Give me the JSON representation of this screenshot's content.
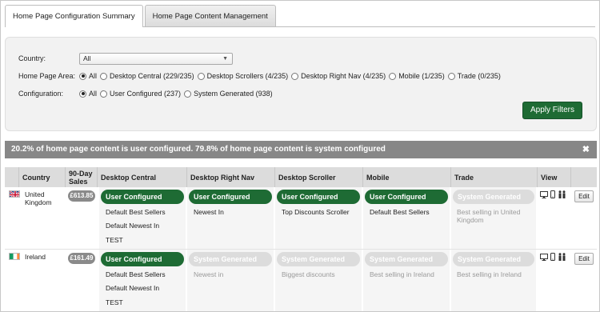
{
  "tabs": [
    {
      "label": "Home Page Configuration Summary",
      "active": true
    },
    {
      "label": "Home Page Content Management",
      "active": false
    }
  ],
  "filters": {
    "country_label": "Country:",
    "country_value": "All",
    "area_label": "Home Page Area:",
    "area_options": [
      "All",
      "Desktop Central (229/235)",
      "Desktop Scrollers (4/235)",
      "Desktop Right Nav (4/235)",
      "Mobile (1/235)",
      "Trade (0/235)"
    ],
    "area_selected": "All",
    "config_label": "Configuration:",
    "config_options": [
      "All",
      "User Configured (237)",
      "System Generated (938)"
    ],
    "config_selected": "All",
    "apply_label": "Apply Filters"
  },
  "summary": {
    "text": "20.2% of home page content is user configured. 79.8% of home page content is system configured",
    "close": "✖"
  },
  "table": {
    "headers": {
      "country": "Country",
      "sales": "90-Day Sales",
      "desktop_central": "Desktop Central",
      "desktop_right_nav": "Desktop Right Nav",
      "desktop_scroller": "Desktop Scroller",
      "mobile": "Mobile",
      "trade": "Trade",
      "view": "View"
    },
    "edit_label": "Edit",
    "rows": [
      {
        "country": "United Kingdom",
        "sales": "£613.85",
        "desktop_central": {
          "status": "User Configured",
          "items": [
            "Default Best Sellers",
            "Default Newest In",
            "TEST"
          ]
        },
        "desktop_right_nav": {
          "status": "User Configured",
          "items": [
            "Newest In"
          ]
        },
        "desktop_scroller": {
          "status": "User Configured",
          "items": [
            "Top Discounts Scroller"
          ]
        },
        "mobile": {
          "status": "User Configured",
          "items": [
            "Default Best Sellers"
          ]
        },
        "trade": {
          "status": "System Generated",
          "items": [
            "Best selling in United Kingdom"
          ]
        }
      },
      {
        "country": "Ireland",
        "sales": "£161.49",
        "desktop_central": {
          "status": "User Configured",
          "items": [
            "Default Best Sellers",
            "Default Newest In",
            "TEST"
          ]
        },
        "desktop_right_nav": {
          "status": "System Generated",
          "items": [
            "Newest in"
          ]
        },
        "desktop_scroller": {
          "status": "System Generated",
          "items": [
            "Biggest discounts"
          ]
        },
        "mobile": {
          "status": "System Generated",
          "items": [
            "Best selling in Ireland"
          ]
        },
        "trade": {
          "status": "System Generated",
          "items": [
            "Best selling in Ireland"
          ]
        }
      }
    ]
  },
  "colors": {
    "user_configured": "#1e6b34",
    "system_generated": "#dcdcdc",
    "summary_bar": "#878787"
  }
}
